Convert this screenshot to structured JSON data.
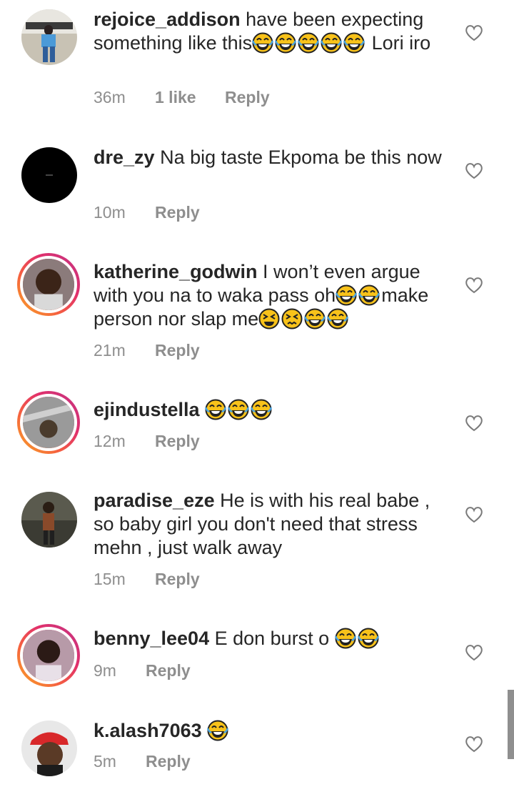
{
  "comments": [
    {
      "username": "rejoice_addison",
      "text_before": " have been expecting something like this",
      "emoji_count": 5,
      "text_after": " Lori iro",
      "time": "36m",
      "likes": "1 like",
      "reply": "Reply",
      "has_story_ring": false
    },
    {
      "username": "dre_zy",
      "text_before": " Na big taste Ekpoma be this now",
      "emoji_count": 0,
      "text_after": "",
      "time": "10m",
      "likes": "",
      "reply": "Reply",
      "has_story_ring": false
    },
    {
      "username": "katherine_godwin",
      "text_before": " I won’t even argue with you na to waka pass oh",
      "emoji_count": 2,
      "text_middle": "make person nor slap me",
      "text_after": "",
      "time": "21m",
      "likes": "",
      "reply": "Reply",
      "has_story_ring": true
    },
    {
      "username": "ejindustella",
      "text_before": " ",
      "emoji_count": 3,
      "text_after": "",
      "time": "12m",
      "likes": "",
      "reply": "Reply",
      "has_story_ring": true
    },
    {
      "username": "paradise_eze",
      "text_before": " He is with his real babe , so baby girl you don't need that stress mehn , just walk away",
      "emoji_count": 0,
      "text_after": "",
      "time": "15m",
      "likes": "",
      "reply": "Reply",
      "has_story_ring": false
    },
    {
      "username": "benny_lee04",
      "text_before": " E don burst o ",
      "emoji_count": 2,
      "text_after": "",
      "time": "9m",
      "likes": "",
      "reply": "Reply",
      "has_story_ring": true
    },
    {
      "username": "k.alash7063",
      "text_before": " ",
      "emoji_count": 1,
      "text_after": "",
      "time": "5m",
      "likes": "",
      "reply": "Reply",
      "has_story_ring": false
    }
  ],
  "icons": {
    "heart": "heart-outline-icon",
    "emoji": "face-with-tears-of-joy-icon"
  },
  "colors": {
    "text": "#262626",
    "meta": "#8e8e8e",
    "emoji_yellow": "#f8c21a"
  }
}
